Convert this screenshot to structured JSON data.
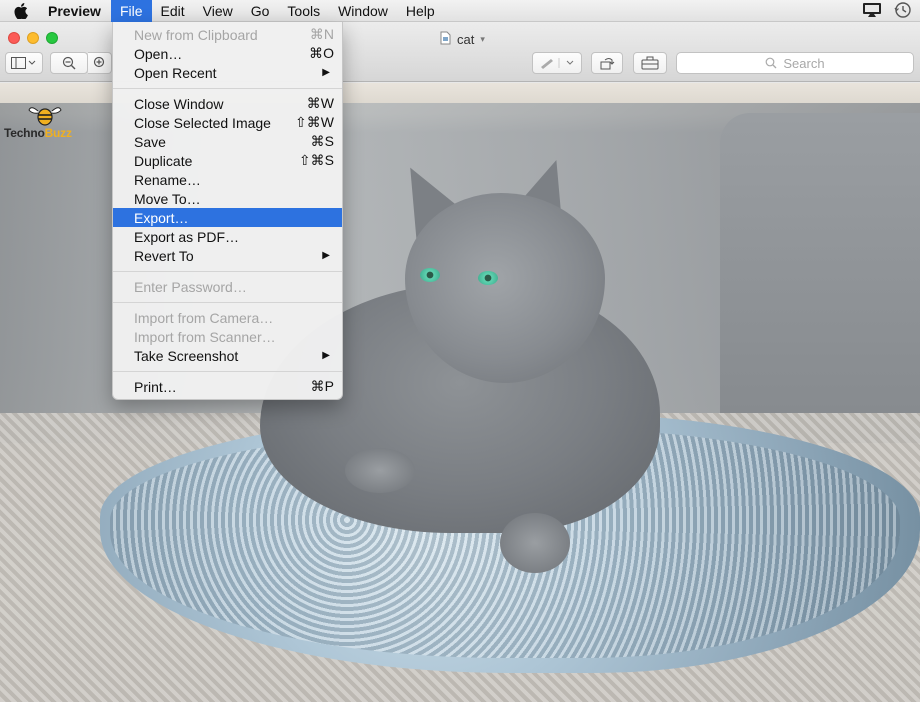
{
  "menubar": {
    "app_name": "Preview",
    "items": [
      "File",
      "Edit",
      "View",
      "Go",
      "Tools",
      "Window",
      "Help"
    ],
    "active_item": "File"
  },
  "window": {
    "title": "cat",
    "search_placeholder": "Search"
  },
  "watermark": {
    "part1": "Techno",
    "part2": "Buzz"
  },
  "file_menu": {
    "g1": [
      {
        "label": "New from Clipboard",
        "shortcut": "⌘N",
        "enabled": false
      },
      {
        "label": "Open…",
        "shortcut": "⌘O",
        "enabled": true
      },
      {
        "label": "Open Recent",
        "submenu": true,
        "enabled": true
      }
    ],
    "g2": [
      {
        "label": "Close Window",
        "shortcut": "⌘W",
        "enabled": true
      },
      {
        "label": "Close Selected Image",
        "shortcut": "⇧⌘W",
        "enabled": true
      },
      {
        "label": "Save",
        "shortcut": "⌘S",
        "enabled": true
      },
      {
        "label": "Duplicate",
        "shortcut": "⇧⌘S",
        "enabled": true
      },
      {
        "label": "Rename…",
        "enabled": true
      },
      {
        "label": "Move To…",
        "enabled": true
      },
      {
        "label": "Export…",
        "enabled": true,
        "highlighted": true
      },
      {
        "label": "Export as PDF…",
        "enabled": true
      },
      {
        "label": "Revert To",
        "submenu": true,
        "enabled": true
      }
    ],
    "g3": [
      {
        "label": "Enter Password…",
        "enabled": false
      }
    ],
    "g4": [
      {
        "label": "Import from Camera…",
        "enabled": false
      },
      {
        "label": "Import from Scanner…",
        "enabled": false
      },
      {
        "label": "Take Screenshot",
        "submenu": true,
        "enabled": true
      }
    ],
    "g5": [
      {
        "label": "Print…",
        "shortcut": "⌘P",
        "enabled": true
      }
    ]
  },
  "colors": {
    "menu_highlight": "#2d72e0",
    "disabled_text": "#a5a5a5"
  }
}
